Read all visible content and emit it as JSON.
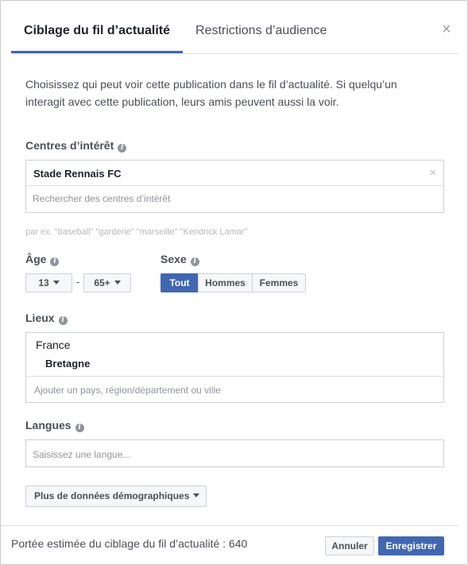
{
  "tabs": {
    "active": "Ciblage du fil d’actualité",
    "inactive": "Restrictions d’audience"
  },
  "close_glyph": "×",
  "description": "Choisissez qui peut voir cette publication dans le fil d’actualité. Si quelqu’un interagit avec cette publication, leurs amis peuvent aussi la voir.",
  "interests": {
    "label": "Centres d’intérêt",
    "selected": "Stade Rennais FC",
    "remove_glyph": "×",
    "placeholder": "Rechercher des centres d’intérêt",
    "hint": "par ex. \"baseball\" \"garderie\" \"marseille\" \"Kendrick Lamar\""
  },
  "age": {
    "label": "Âge",
    "min": "13",
    "separator": "-",
    "max": "65+"
  },
  "gender": {
    "label": "Sexe",
    "options": [
      "Tout",
      "Hommes",
      "Femmes"
    ],
    "selected": "Tout"
  },
  "locations": {
    "label": "Lieux",
    "country": "France",
    "region": "Bretagne",
    "placeholder": "Ajouter un pays, région/département ou ville"
  },
  "languages": {
    "label": "Langues",
    "placeholder": "Saisissez une langue..."
  },
  "more_demographics": "Plus de données démographiques",
  "footer": {
    "reach_text": "Portée estimée du ciblage du fil d’actualité : 640",
    "cancel": "Annuler",
    "save": "Enregistrer"
  },
  "colors": {
    "accent": "#4267b2",
    "border": "#ccd0d5",
    "text": "#4b4f56"
  },
  "icons": {
    "info": "info-icon",
    "close": "close-icon",
    "caret": "caret-down-icon"
  }
}
